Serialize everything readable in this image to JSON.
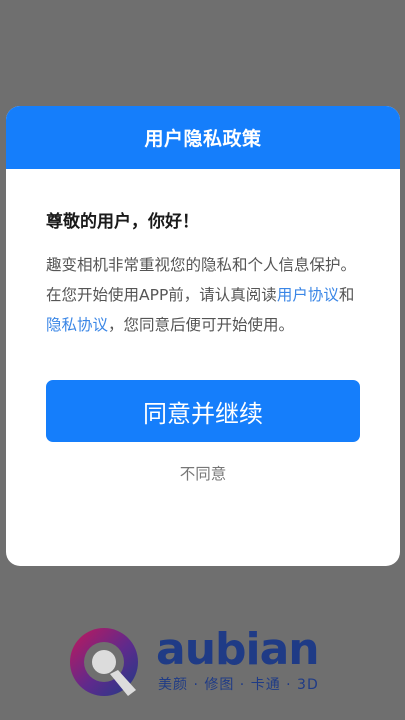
{
  "dialog": {
    "title": "用户隐私政策",
    "greeting": "尊敬的用户，你好！",
    "message_part1": "趣变相机非常重视您的隐私和个人信息保护。在您开始使用APP前，请认真阅读",
    "user_agreement_link": "用户协议",
    "conjunction": "和",
    "privacy_link": "隐私协议",
    "message_part2": "，您同意后便可开始使用。",
    "agree_button": "同意并继续",
    "disagree_button": "不同意"
  },
  "brand": {
    "wordmark": "aubian",
    "tagline": "美颜 · 修图 · 卡通 · 3D"
  },
  "colors": {
    "accent": "#157efb",
    "link": "#3a86e6",
    "overlay": "#6f6f6f",
    "brand": "#1f3b86"
  }
}
